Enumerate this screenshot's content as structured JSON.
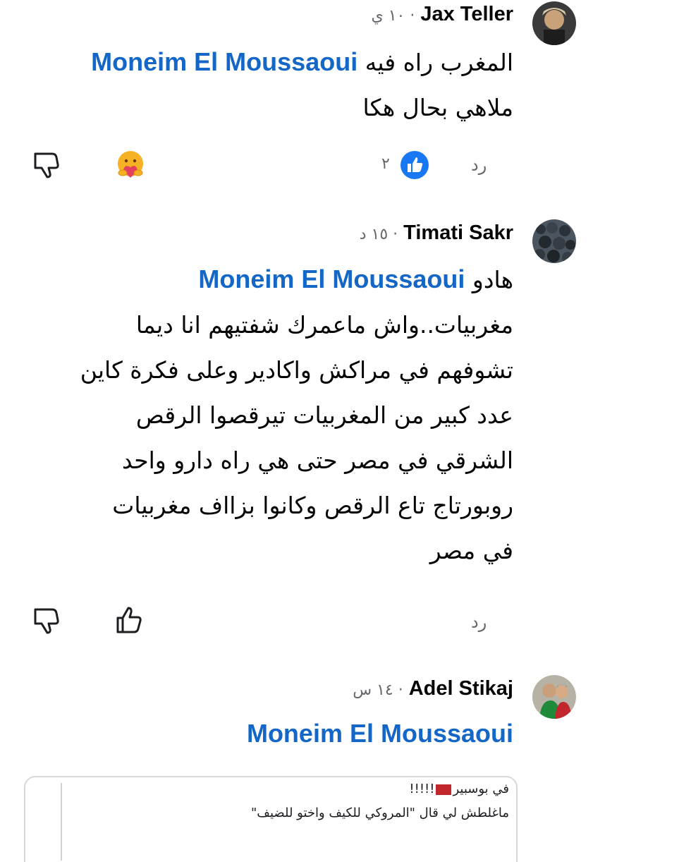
{
  "comments": [
    {
      "author": "Jax Teller",
      "time": "١٠ ي",
      "mention": "Moneim El Moussaoui",
      "text_first": "المغرب راه فيه",
      "lines": [
        "ملاهي بحال هكا"
      ],
      "reply_label": "رد",
      "like_count": "٢"
    },
    {
      "author": "Timati Sakr",
      "time": "١٥ د",
      "mention": "Moneim El Moussaoui",
      "text_first": "هادو",
      "lines": [
        "مغربيات..واش ماعمرك شفتيهم انا ديما",
        "تشوفهم في مراكش واكادير وعلى فكرة كاين",
        "عدد كبير من المغربيات تيرقصوا الرقص",
        "الشرقي في مصر حتى هي راه دارو واحد",
        "روبورتاج تاع الرقص وكانوا بزااف مغربيات",
        "في مصر"
      ],
      "reply_label": "رد"
    },
    {
      "author": "Adel Stikaj",
      "time": "١٤ س",
      "mention": "Moneim El Moussaoui",
      "quote_line1_a": "في بوسبير",
      "quote_line1_b": "!!!!!",
      "quote_line2": "ماغلطش لي قال \"المروكي للكيف واختو للضيف\""
    }
  ],
  "dot": "·",
  "icons": {
    "dislike": "thumb-down-outline-icon",
    "care_reaction": "care-reaction-icon",
    "like_reaction": "like-reaction-icon",
    "like": "thumb-up-outline-icon"
  },
  "colors": {
    "mention": "#1467c7",
    "like_blue": "#1877f2",
    "care_yellow": "#f7b125",
    "flag_red": "#c1272d"
  }
}
